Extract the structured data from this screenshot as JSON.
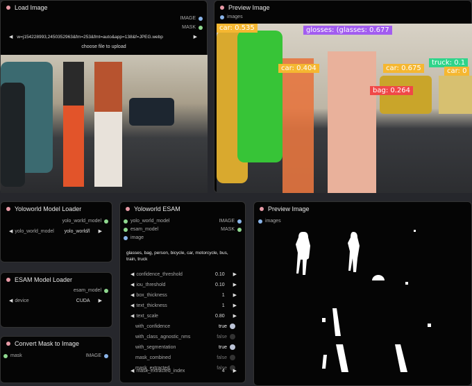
{
  "load_image": {
    "title": "Load Image",
    "outputs": [
      "IMAGE",
      "MASK"
    ],
    "filename": "w=j154228993,2450352963&fm=253&fmt=auto&app=138&f=JPEG.webp",
    "upload": "choose file to upload"
  },
  "preview_top": {
    "title": "Preview Image",
    "input": "images",
    "labels": [
      {
        "text": "car: 0.535",
        "color": "#f5b731"
      },
      {
        "text": "glosses: (glasses: 0.677",
        "color": "#a25cf0"
      },
      {
        "text": "car: 0.404",
        "color": "#f5b731"
      },
      {
        "text": "car: 0.675",
        "color": "#f5b731"
      },
      {
        "text": "truck: 0.1",
        "color": "#2ed48a"
      },
      {
        "text": "car: 0",
        "color": "#f5b731"
      },
      {
        "text": "bag: 0.264",
        "color": "#f04848"
      }
    ]
  },
  "yolo_loader": {
    "title": "Yoloworld Model Loader",
    "output": "yolo_world_model",
    "widget_label": "yolo_world_model",
    "widget_value": "yolo_world/l"
  },
  "esam_loader": {
    "title": "ESAM Model Loader",
    "output": "esam_model",
    "widget_label": "device",
    "widget_value": "CUDA"
  },
  "convert_mask": {
    "title": "Convert Mask to Image",
    "input": "mask",
    "output": "IMAGE"
  },
  "yolo_esam": {
    "title": "Yoloworld ESAM",
    "inputs": [
      "yolo_world_model",
      "esam_model",
      "image"
    ],
    "outputs": [
      "IMAGE",
      "MASK"
    ],
    "categories": "glasses, bag, person,  bicycle, car, motorcycle, bus, train, truck",
    "numbers": [
      {
        "label": "confidence_threshold",
        "value": "0.10"
      },
      {
        "label": "iou_threshold",
        "value": "0.10"
      },
      {
        "label": "box_thickness",
        "value": "1"
      },
      {
        "label": "text_thickness",
        "value": "1"
      },
      {
        "label": "text_scale",
        "value": "0.80"
      }
    ],
    "toggles": [
      {
        "label": "with_confidence",
        "value": "true"
      },
      {
        "label": "with_class_agnostic_nms",
        "value": "false"
      },
      {
        "label": "with_segmentation",
        "value": "true"
      },
      {
        "label": "mask_combined",
        "value": "false"
      },
      {
        "label": "mask_extracted",
        "value": "false"
      }
    ],
    "index": {
      "label": "mask_extracted_index",
      "value": "4"
    }
  },
  "preview_bottom": {
    "title": "Preview Image",
    "input": "images"
  }
}
